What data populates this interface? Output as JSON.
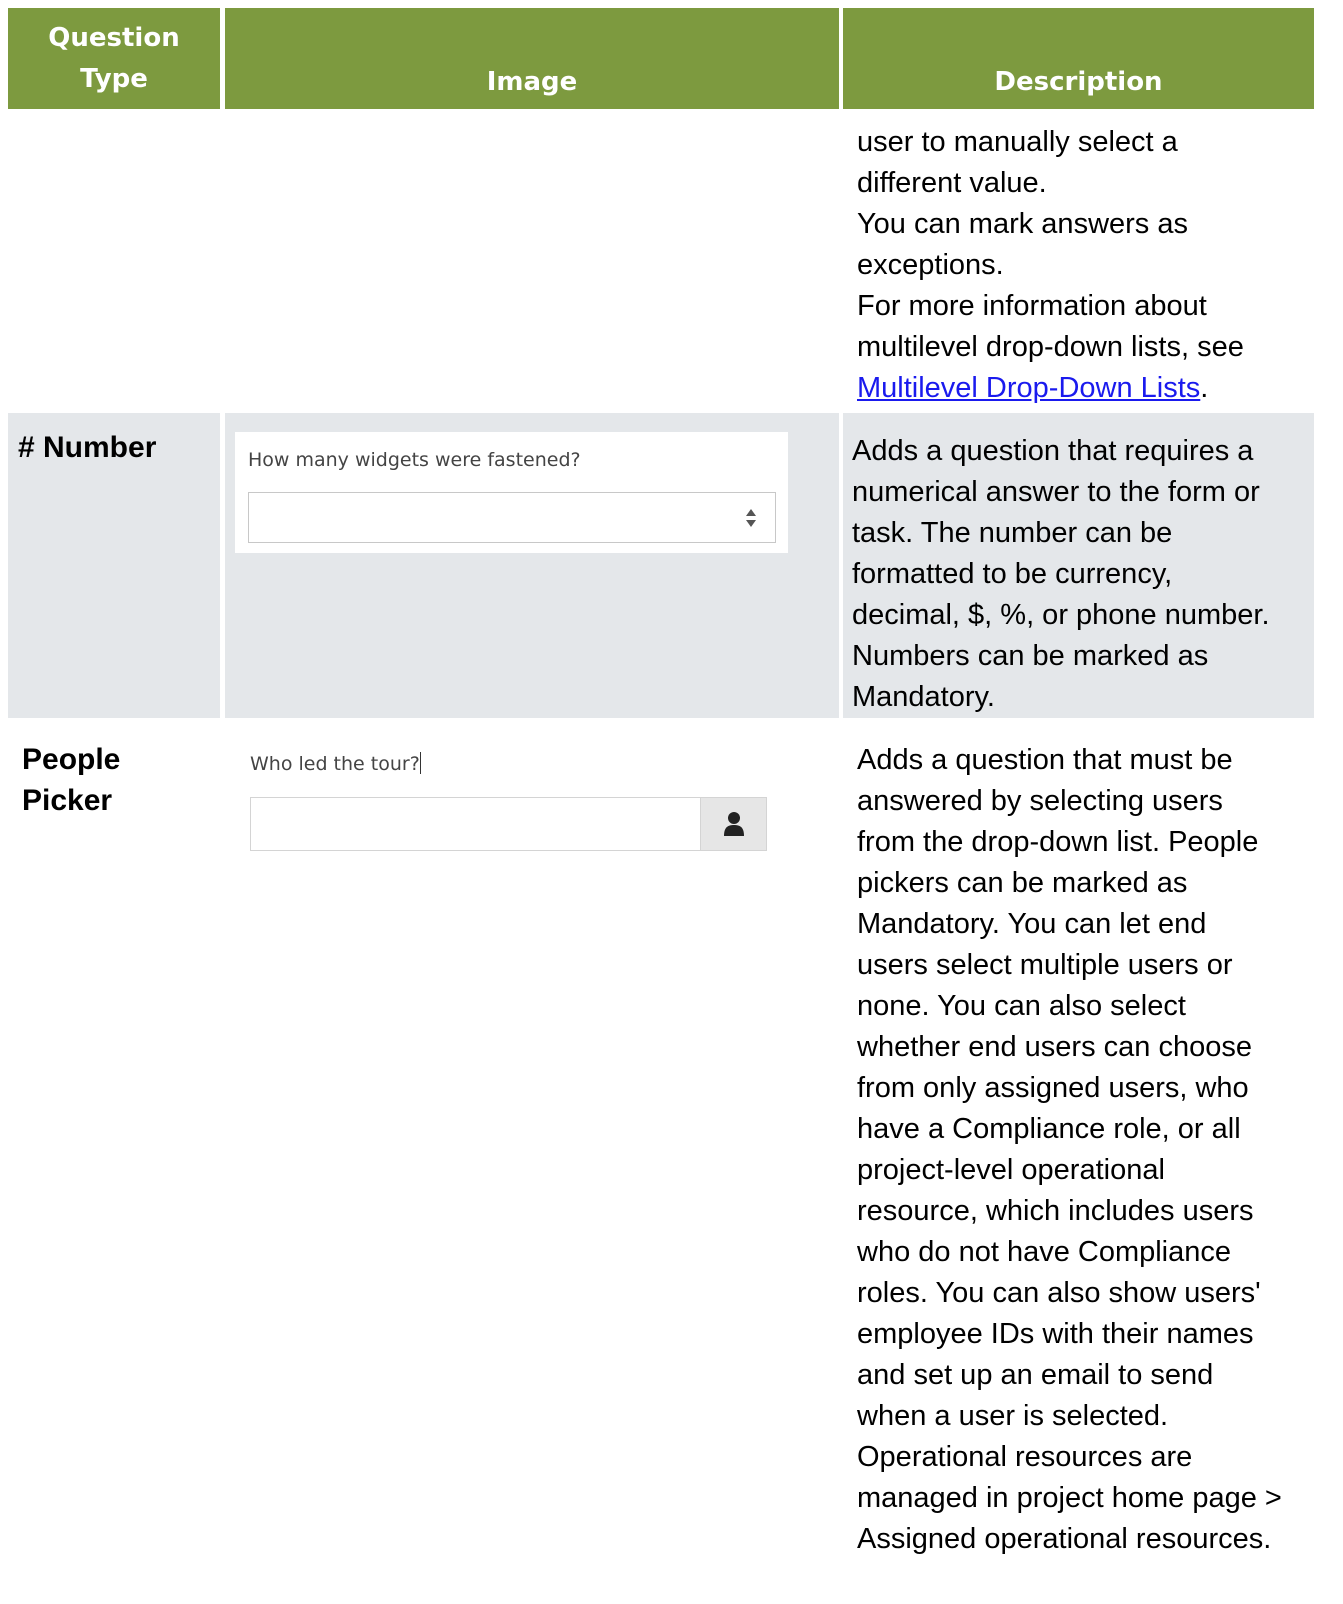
{
  "header": {
    "type_line1": "Question",
    "type_line2": "Type",
    "image": "Image",
    "description": "Description"
  },
  "continued_row": {
    "lines": [
      "user to manually select a",
      "different value.",
      "You can mark answers as",
      "exceptions.",
      "For more information about",
      "multilevel drop-down lists, see"
    ],
    "link_text": "Multilevel Drop-Down Lists",
    "link_suffix": "."
  },
  "number_row": {
    "type": "# Number",
    "question": "How many widgets were fastened?",
    "input_value": "",
    "description_lines": [
      "Adds a question that requires a",
      "numerical answer to the form or",
      "task. The number can be",
      "formatted to be currency,",
      "decimal, $, %, or phone number.",
      "Numbers can be marked as",
      "Mandatory."
    ]
  },
  "people_row": {
    "type_line1": "People",
    "type_line2": "Picker",
    "question": "Who led the tour?",
    "input_value": "",
    "description_lines": [
      "Adds a question that must be",
      "answered by selecting users",
      "from the drop-down list. People",
      "pickers can be marked as",
      "Mandatory. You can let end",
      "users select multiple users or",
      "none. You can also select",
      "whether end users can choose",
      "from only assigned users, who",
      "have a Compliance role, or all",
      "project-level operational",
      "resource, which includes users",
      "who do not have Compliance",
      "roles. You can also show users'",
      "employee IDs with their names",
      "and set up an email to send",
      "when a user is selected.",
      "Operational resources are",
      "managed in project home page >",
      "Assigned operational resources."
    ]
  },
  "colors": {
    "header_bg": "#7d9a3f",
    "row_shade": "#e4e7ea",
    "link": "#1a1aee"
  },
  "icons": {
    "spinner": "up-down-spinner-icon",
    "person": "person-icon"
  }
}
